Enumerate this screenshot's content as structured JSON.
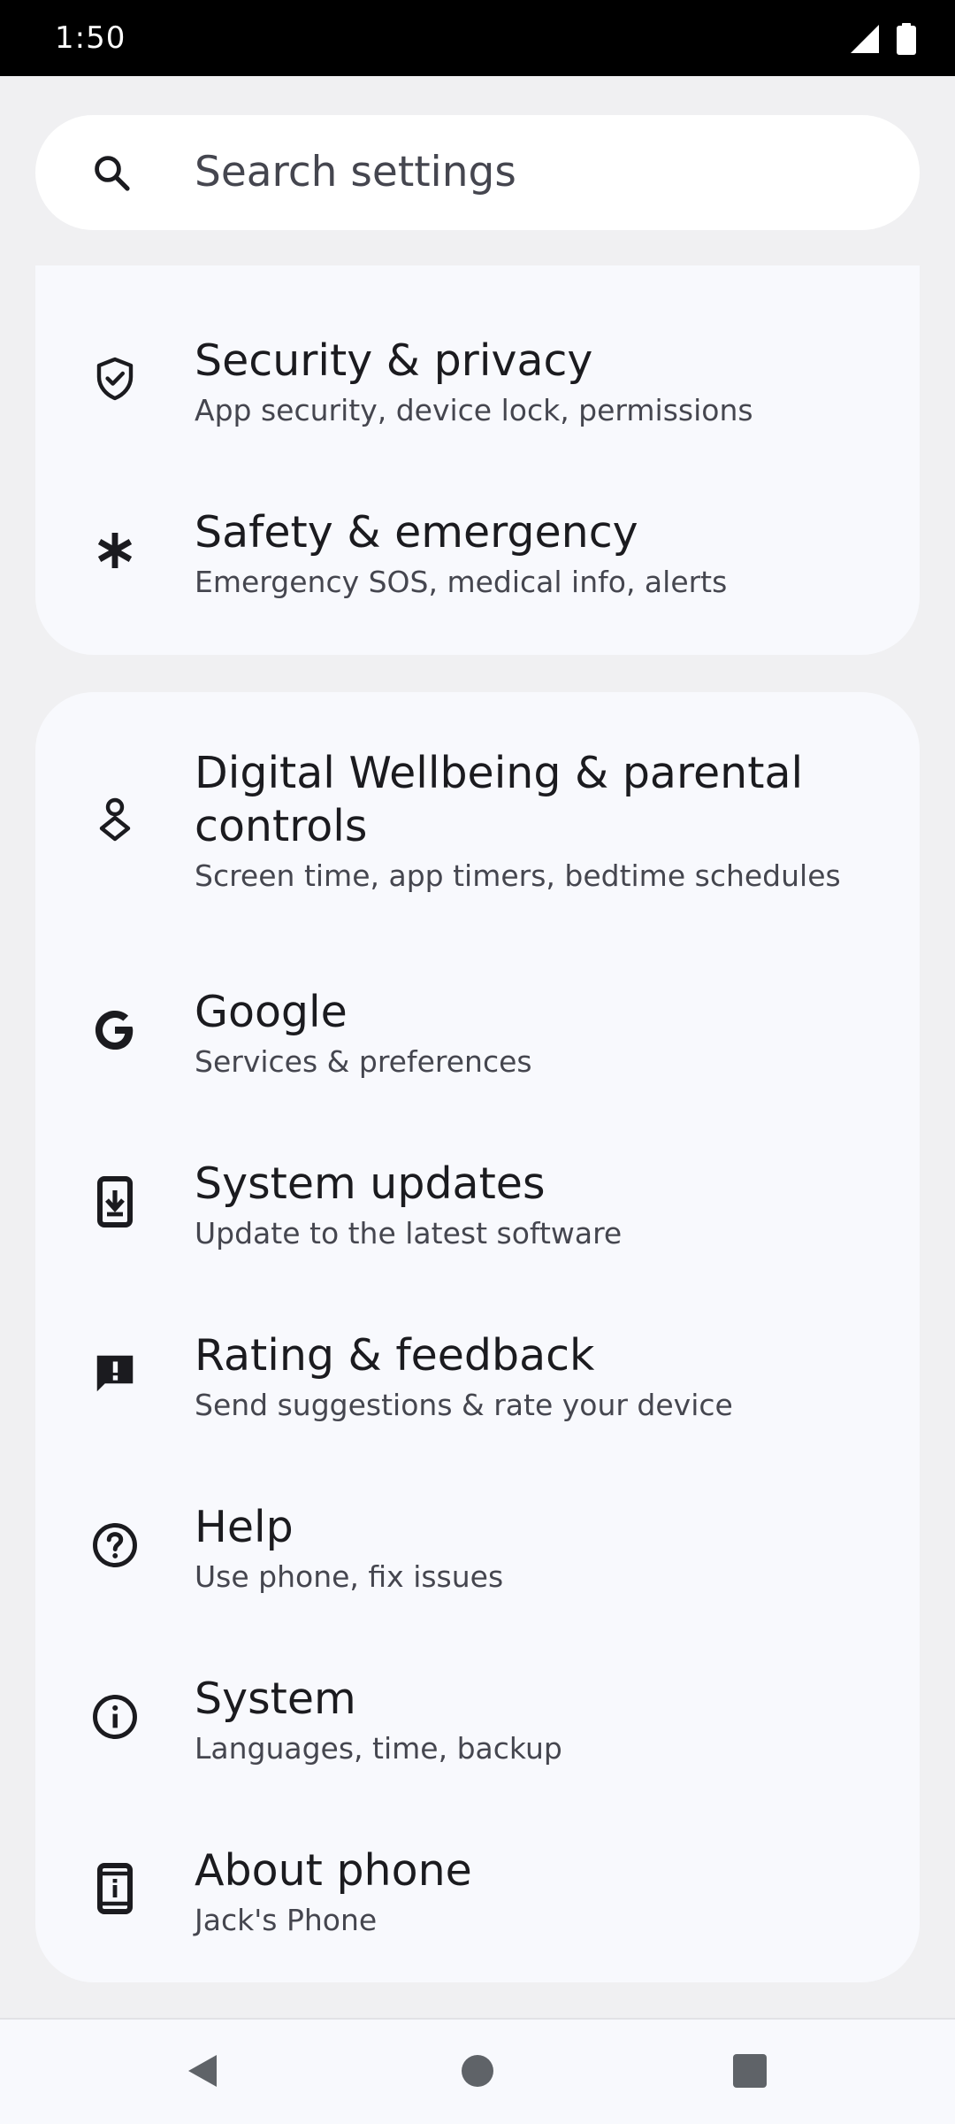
{
  "status_bar": {
    "time": "1:50",
    "icons": [
      "signal-icon",
      "battery-icon"
    ]
  },
  "search": {
    "placeholder": "Search settings",
    "icon": "search-icon"
  },
  "top_card": {
    "items": [
      {
        "icon": "shield-check-icon",
        "title": "Security & privacy",
        "subtitle": "App security, device lock, permissions"
      },
      {
        "icon": "asterisk-icon",
        "title": "Safety & emergency",
        "subtitle": "Emergency SOS, medical info, alerts"
      }
    ]
  },
  "main_card": {
    "items": [
      {
        "icon": "wellbeing-icon",
        "title": "Digital Wellbeing & parental controls",
        "subtitle": "Screen time, app timers, bedtime schedules"
      },
      {
        "icon": "google-icon",
        "title": "Google",
        "subtitle": "Services & preferences"
      },
      {
        "icon": "system-update-icon",
        "title": "System updates",
        "subtitle": "Update to the latest software"
      },
      {
        "icon": "feedback-icon",
        "title": "Rating & feedback",
        "subtitle": "Send suggestions & rate your device"
      },
      {
        "icon": "help-icon",
        "title": "Help",
        "subtitle": "Use phone, fix issues"
      },
      {
        "icon": "info-icon",
        "title": "System",
        "subtitle": "Languages, time, backup"
      },
      {
        "icon": "about-phone-icon",
        "title": "About phone",
        "subtitle": "Jack's Phone"
      }
    ]
  },
  "nav_bar": {
    "buttons": [
      "back-icon",
      "home-icon",
      "recents-icon"
    ]
  },
  "colors": {
    "background": "#f0f0f2",
    "card": "#f8f9fd",
    "text_primary": "#1b1b1f",
    "text_secondary": "#45464f",
    "status_bar": "#000000"
  }
}
